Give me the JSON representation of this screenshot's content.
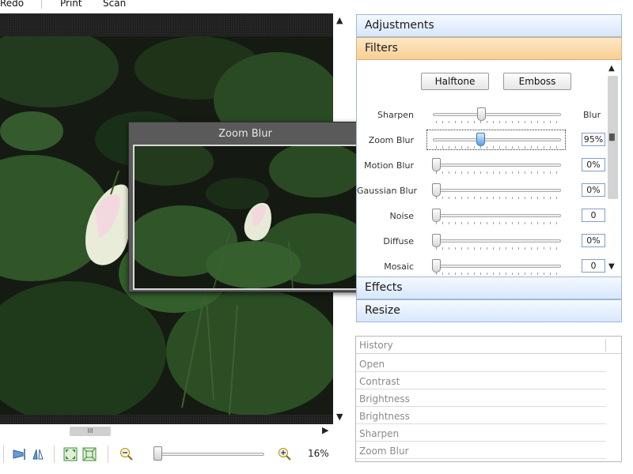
{
  "menu": {
    "items": [
      "Redo",
      "Print",
      "Scan"
    ]
  },
  "dialog": {
    "title": "Zoom Blur"
  },
  "zoom": {
    "label": "16%",
    "level": 0.03
  },
  "panel": {
    "adjustments_label": "Adjustments",
    "filters_label": "Filters",
    "effects_label": "Effects",
    "resize_label": "Resize",
    "halftone_label": "Halftone",
    "emboss_label": "Emboss",
    "filters": [
      {
        "label": "Sharpen",
        "value": "Blur",
        "level": 0.38,
        "type": "text"
      },
      {
        "label": "Zoom Blur",
        "value": "95%",
        "level": 0.37,
        "type": "box",
        "active": true
      },
      {
        "label": "Motion Blur",
        "value": "0%",
        "level": 0.0,
        "type": "box"
      },
      {
        "label": "Gaussian Blur",
        "value": "0%",
        "level": 0.0,
        "type": "box"
      },
      {
        "label": "Noise",
        "value": "0",
        "level": 0.0,
        "type": "box"
      },
      {
        "label": "Diffuse",
        "value": "0%",
        "level": 0.0,
        "type": "box"
      },
      {
        "label": "Mosaic",
        "value": "0",
        "level": 0.0,
        "type": "box"
      }
    ]
  },
  "history": {
    "header": "History",
    "items": [
      "Open",
      "Contrast",
      "Brightness",
      "Brightness",
      "Sharpen",
      "Zoom Blur"
    ]
  },
  "colors": {
    "accent_header": "#f8cf93",
    "panel_header": "#d7e7fb",
    "slider_active": "#5aa0e6"
  }
}
